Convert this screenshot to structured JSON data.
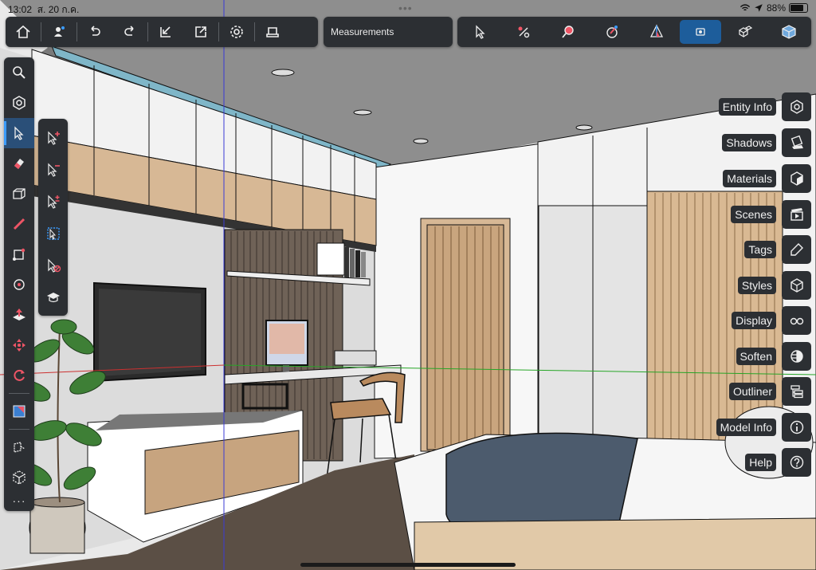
{
  "status_bar": {
    "time": "13:02",
    "date": "ส. 20 ก.ค.",
    "battery": "88%",
    "battery_level": 0.88
  },
  "top_toolbar": {
    "left_buttons": [
      "home-icon",
      "account-icon",
      "undo-icon",
      "redo-icon",
      "import-icon",
      "export-icon",
      "settings-icon",
      "print-icon"
    ],
    "measurements_placeholder": "Measurements",
    "right_tools": [
      "select-icon",
      "orbit-icon",
      "search-view-icon",
      "xray-icon",
      "section-icon",
      "camera-active-icon",
      "components-icon",
      "cube-icon"
    ]
  },
  "left_toolbar": {
    "tools": [
      "search-icon",
      "orbit-tool-icon",
      "select-tool-icon",
      "eraser-icon",
      "box-icon",
      "pencil-icon",
      "rectangle-icon",
      "circle-icon",
      "push-pull-icon",
      "move-icon",
      "rotate-icon",
      "paint-bucket-icon",
      "tape-measure-icon",
      "component-icon"
    ],
    "more_label": "···"
  },
  "flyout": {
    "tools": [
      "select-add-icon",
      "select-subtract-icon",
      "select-toggle-icon",
      "select-all-icon",
      "deselect-icon",
      "learn-icon"
    ]
  },
  "right_panels": [
    {
      "label": "Entity Info",
      "icon": "entity-info-icon"
    },
    {
      "label": "Shadows",
      "icon": "shadows-icon"
    },
    {
      "label": "Materials",
      "icon": "materials-icon"
    },
    {
      "label": "Scenes",
      "icon": "scenes-icon"
    },
    {
      "label": "Tags",
      "icon": "tags-icon"
    },
    {
      "label": "Styles",
      "icon": "styles-icon"
    },
    {
      "label": "Display",
      "icon": "display-icon"
    },
    {
      "label": "Soften",
      "icon": "soften-icon"
    },
    {
      "label": "Outliner",
      "icon": "outliner-icon"
    },
    {
      "label": "Model Info",
      "icon": "model-info-icon"
    },
    {
      "label": "Help",
      "icon": "help-icon"
    }
  ],
  "colors": {
    "panel": "#2c2f33",
    "active": "#1d5d9b",
    "accent": "#3b9cff"
  }
}
